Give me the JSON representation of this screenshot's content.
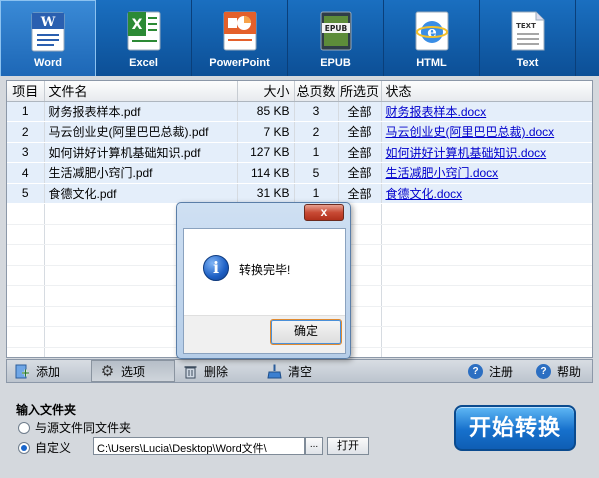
{
  "formats": [
    {
      "label": "Word",
      "icon": "word-icon",
      "active": true
    },
    {
      "label": "Excel",
      "icon": "excel-icon",
      "active": false
    },
    {
      "label": "PowerPoint",
      "icon": "powerpoint-icon",
      "active": false
    },
    {
      "label": "EPUB",
      "icon": "epub-icon",
      "active": false
    },
    {
      "label": "HTML",
      "icon": "html-icon",
      "active": false
    },
    {
      "label": "Text",
      "icon": "text-icon",
      "active": false
    }
  ],
  "table": {
    "headers": [
      "项目",
      "文件名",
      "大小",
      "总页数",
      "所选页",
      "状态"
    ],
    "rows": [
      {
        "index": "1",
        "name": "财务报表样本.pdf",
        "size": "85  KB",
        "pages": "3",
        "selected": "全部",
        "status": "财务报表样本.docx"
      },
      {
        "index": "2",
        "name": "马云创业史(阿里巴巴总裁).pdf",
        "size": "7  KB",
        "pages": "2",
        "selected": "全部",
        "status": "马云创业史(阿里巴巴总裁).docx"
      },
      {
        "index": "3",
        "name": "如何讲好计算机基础知识.pdf",
        "size": "127  KB",
        "pages": "1",
        "selected": "全部",
        "status": "如何讲好计算机基础知识.docx"
      },
      {
        "index": "4",
        "name": "生活减肥小窍门.pdf",
        "size": "114  KB",
        "pages": "5",
        "selected": "全部",
        "status": "生活减肥小窍门.docx"
      },
      {
        "index": "5",
        "name": "食德文化.pdf",
        "size": "31  KB",
        "pages": "1",
        "selected": "全部",
        "status": "食德文化.docx"
      }
    ]
  },
  "toolbar": {
    "add": "添加",
    "options": "选项",
    "delete": "删除",
    "clear": "清空",
    "register": "注册",
    "help": "帮助"
  },
  "input": {
    "title": "输入文件夹",
    "same_as_source": "与源文件同文件夹",
    "custom": "自定义",
    "path": "C:\\Users\\Lucia\\Desktop\\Word文件\\",
    "browse": "...",
    "open": "打开",
    "start": "开始转换"
  },
  "dialog": {
    "close": "x",
    "message": "转换完毕!",
    "ok": "确定"
  },
  "colors": {
    "accent": "#1a6fc0",
    "link": "#0000cc",
    "row_highlight": "#e4eefa"
  }
}
